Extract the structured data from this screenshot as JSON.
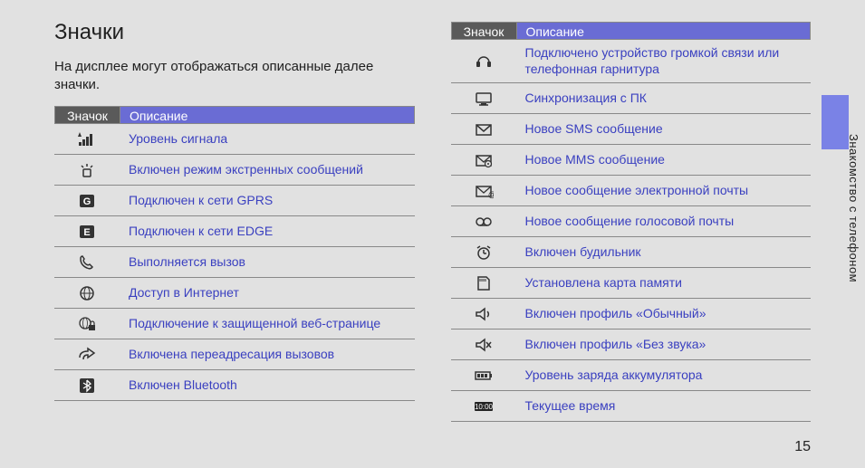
{
  "title": "Значки",
  "intro": "На дисплее могут отображаться описанные далее значки.",
  "header_icon": "Значок",
  "header_desc": "Описание",
  "side_label": "Знакомство с телефоном",
  "page_number": "15",
  "left_rows": [
    {
      "icon": "signal-icon",
      "desc": "Уровень сигнала"
    },
    {
      "icon": "emergency-icon",
      "desc": "Включен режим экстренных сообщений"
    },
    {
      "icon": "gprs-icon",
      "desc": "Подключен к сети GPRS"
    },
    {
      "icon": "edge-icon",
      "desc": "Подключен к сети EDGE"
    },
    {
      "icon": "call-icon",
      "desc": "Выполняется вызов"
    },
    {
      "icon": "internet-icon",
      "desc": "Доступ в Интернет"
    },
    {
      "icon": "secure-web-icon",
      "desc": "Подключение к защищенной веб-странице"
    },
    {
      "icon": "forward-icon",
      "desc": "Включена переадресация вызовов"
    },
    {
      "icon": "bluetooth-icon",
      "desc": "Включен Bluetooth"
    }
  ],
  "right_rows": [
    {
      "icon": "headset-icon",
      "desc": "Подключено устройство громкой связи или телефонная гарнитура"
    },
    {
      "icon": "pc-sync-icon",
      "desc": "Синхронизация с ПК"
    },
    {
      "icon": "sms-icon",
      "desc": "Новое SMS сообщение"
    },
    {
      "icon": "mms-icon",
      "desc": "Новое MMS сообщение"
    },
    {
      "icon": "email-icon",
      "desc": "Новое сообщение электронной почты"
    },
    {
      "icon": "voicemail-icon",
      "desc": "Новое сообщение голосовой почты"
    },
    {
      "icon": "alarm-icon",
      "desc": "Включен будильник"
    },
    {
      "icon": "memory-card-icon",
      "desc": "Установлена карта памяти"
    },
    {
      "icon": "sound-on-icon",
      "desc": "Включен профиль «Обычный»"
    },
    {
      "icon": "sound-off-icon",
      "desc": "Включен профиль «Без звука»"
    },
    {
      "icon": "battery-icon",
      "desc": "Уровень заряда аккумулятора"
    },
    {
      "icon": "clock-icon",
      "desc": "Текущее время"
    }
  ]
}
